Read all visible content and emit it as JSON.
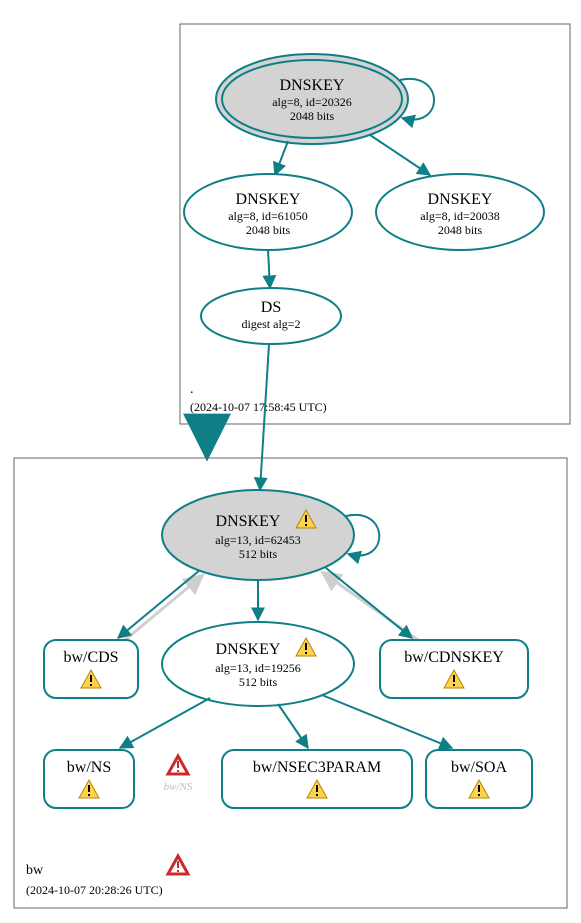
{
  "colors": {
    "stroke": "#0f7f87",
    "fill_grey": "#d3d3d3",
    "fill_white": "#ffffff",
    "edge_grey": "#cfcfcf",
    "box_border": "#666666",
    "warn_yellow": "#ffd24d",
    "warn_red": "#cc2a2a"
  },
  "chart_data": {
    "type": "diagram",
    "title": "DNSSEC delegation / key graph",
    "zones": [
      {
        "id": "root",
        "label": ".",
        "timestamp": "(2024-10-07 17:58:45 UTC)",
        "nodes": [
          {
            "id": "root_ksk",
            "kind": "DNSKEY",
            "title": "DNSKEY",
            "lines": [
              "alg=8, id=20326",
              "2048 bits"
            ],
            "shape": "ellipse_double",
            "selfloop": true
          },
          {
            "id": "root_zsk1",
            "kind": "DNSKEY",
            "title": "DNSKEY",
            "lines": [
              "alg=8, id=61050",
              "2048 bits"
            ],
            "shape": "ellipse"
          },
          {
            "id": "root_zsk2",
            "kind": "DNSKEY",
            "title": "DNSKEY",
            "lines": [
              "alg=8, id=20038",
              "2048 bits"
            ],
            "shape": "ellipse"
          },
          {
            "id": "root_ds",
            "kind": "DS",
            "title": "DS",
            "lines": [
              "digest alg=2"
            ],
            "shape": "ellipse"
          }
        ],
        "edges": [
          {
            "from": "root_ksk",
            "to": "root_ksk",
            "style": "teal"
          },
          {
            "from": "root_ksk",
            "to": "root_zsk1",
            "style": "teal"
          },
          {
            "from": "root_ksk",
            "to": "root_zsk2",
            "style": "teal"
          },
          {
            "from": "root_zsk1",
            "to": "root_ds",
            "style": "teal"
          }
        ]
      },
      {
        "id": "bw",
        "label": "bw",
        "timestamp": "(2024-10-07 20:28:26 UTC)",
        "zone_warning": "red",
        "nodes": [
          {
            "id": "bw_ksk",
            "kind": "DNSKEY",
            "title": "DNSKEY",
            "lines": [
              "alg=13, id=62453",
              "512 bits"
            ],
            "shape": "ellipse_grey",
            "warning": "yellow",
            "selfloop": true
          },
          {
            "id": "bw_zsk",
            "kind": "DNSKEY",
            "title": "DNSKEY",
            "lines": [
              "alg=13, id=19256",
              "512 bits"
            ],
            "shape": "ellipse",
            "warning": "yellow"
          },
          {
            "id": "bw_cds",
            "kind": "RRset",
            "title": "bw/CDS",
            "shape": "rrect",
            "warning": "yellow"
          },
          {
            "id": "bw_cdnskey",
            "kind": "RRset",
            "title": "bw/CDNSKEY",
            "shape": "rrect",
            "warning": "yellow"
          },
          {
            "id": "bw_ns",
            "kind": "RRset",
            "title": "bw/NS",
            "shape": "rrect",
            "warning": "yellow"
          },
          {
            "id": "bw_nsec3param",
            "kind": "RRset",
            "title": "bw/NSEC3PARAM",
            "shape": "rrect",
            "warning": "yellow"
          },
          {
            "id": "bw_soa",
            "kind": "RRset",
            "title": "bw/SOA",
            "shape": "rrect",
            "warning": "yellow"
          },
          {
            "id": "bw_ns_ghost",
            "kind": "ghost",
            "title": "bw/NS",
            "warning": "red"
          }
        ],
        "edges": [
          {
            "from": "root_ds",
            "to": "bw_ksk",
            "style": "teal"
          },
          {
            "from": "bw_ksk",
            "to": "bw_ksk",
            "style": "teal"
          },
          {
            "from": "bw_ksk",
            "to": "bw_zsk",
            "style": "teal"
          },
          {
            "from": "bw_ksk",
            "to": "bw_cds",
            "style": "teal"
          },
          {
            "from": "bw_ksk",
            "to": "bw_cdnskey",
            "style": "teal"
          },
          {
            "from": "bw_cds",
            "to": "bw_ksk",
            "style": "grey"
          },
          {
            "from": "bw_cdnskey",
            "to": "bw_ksk",
            "style": "grey"
          },
          {
            "from": "bw_zsk",
            "to": "bw_ns",
            "style": "teal"
          },
          {
            "from": "bw_zsk",
            "to": "bw_nsec3param",
            "style": "teal"
          },
          {
            "from": "bw_zsk",
            "to": "bw_soa",
            "style": "teal"
          }
        ]
      }
    ],
    "inter_zone_edge": {
      "from_zone": "root",
      "to_zone": "bw",
      "style": "teal_thick"
    }
  }
}
